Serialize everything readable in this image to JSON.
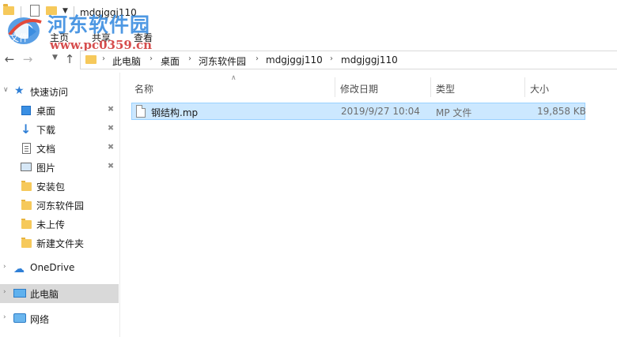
{
  "window": {
    "title": "mdgjggj110"
  },
  "watermark": {
    "name": "河东软件园",
    "url": "www.pc0359.cn"
  },
  "ribbon": {
    "tabs": [
      "主页",
      "共享",
      "查看"
    ]
  },
  "address": {
    "crumbs": [
      "此电脑",
      "桌面",
      "河东软件园",
      "mdgjggj110",
      "mdgjggj110"
    ]
  },
  "nav": {
    "quick_access": "快速访问",
    "items": [
      {
        "label": "桌面",
        "icon": "desktop-icon",
        "pinned": true
      },
      {
        "label": "下载",
        "icon": "download-icon",
        "pinned": true
      },
      {
        "label": "文档",
        "icon": "documents-icon",
        "pinned": true
      },
      {
        "label": "图片",
        "icon": "pictures-icon",
        "pinned": true
      },
      {
        "label": "安装包",
        "icon": "folder-icon",
        "pinned": false
      },
      {
        "label": "河东软件园",
        "icon": "folder-icon",
        "pinned": false
      },
      {
        "label": "未上传",
        "icon": "folder-icon",
        "pinned": false
      },
      {
        "label": "新建文件夹",
        "icon": "folder-icon",
        "pinned": false
      }
    ],
    "onedrive": "OneDrive",
    "this_pc": "此电脑",
    "network": "网络"
  },
  "columns": {
    "name": "名称",
    "modified": "修改日期",
    "type": "类型",
    "size": "大小"
  },
  "files": [
    {
      "name": "钢结构.mp",
      "modified": "2019/9/27 10:04",
      "type": "MP 文件",
      "size": "19,858 KB"
    }
  ],
  "colors": {
    "selection_bg": "#cce8ff",
    "selection_border": "#99d1ff",
    "folder": "#f6c95b",
    "accent": "#2f7fd6"
  }
}
